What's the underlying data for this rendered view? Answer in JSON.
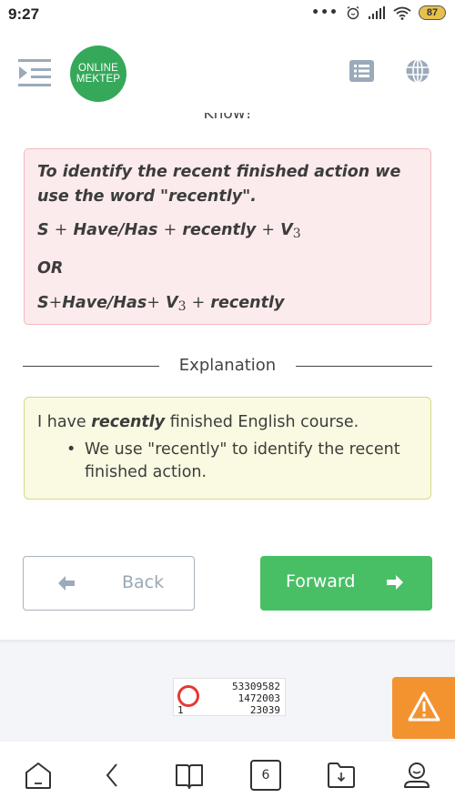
{
  "status_bar": {
    "time": "9:27",
    "icons": [
      "more-dots-icon",
      "alarm-icon",
      "signal-icon",
      "wifi-icon"
    ],
    "battery": "87"
  },
  "header": {
    "logo_line1": "ONLINE",
    "logo_line2": "MEKTEP",
    "icons": [
      "menu-collapse-icon",
      "list-icon",
      "globe-icon"
    ]
  },
  "partial_heading": "Know!",
  "rule": {
    "intro": "To identify the recent finished action we use the word \"recently\".",
    "formula1": {
      "s": "S",
      "have": "Have/Has",
      "recently": "recently",
      "v": "V",
      "sub": "3"
    },
    "or": "OR",
    "formula2": {
      "s": "S",
      "have": "Have/Has",
      "v": "V",
      "sub": "3",
      "recently": "recently"
    },
    "plus": "+"
  },
  "explanation": {
    "label": "Explanation",
    "sentence_pre": "I have ",
    "sentence_bold": "recently",
    "sentence_post": " finished English course.",
    "bullet": "We use \"recently\" to identify the recent finished action."
  },
  "buttons": {
    "back": "Back",
    "forward": "Forward"
  },
  "counter": {
    "line1": "53309582",
    "line2": "1472003",
    "line3": "23039",
    "index": "1"
  },
  "bottom_nav": {
    "badge": "6",
    "items": [
      "home-icon",
      "back-icon",
      "book-icon",
      "tabs-icon",
      "downloads-icon",
      "profile-icon"
    ]
  },
  "colors": {
    "brand_green": "#36a85a",
    "forward_green": "#48bf65",
    "warning_orange": "#f39330",
    "rule_bg": "#fcebec",
    "example_bg": "#fafae2"
  }
}
